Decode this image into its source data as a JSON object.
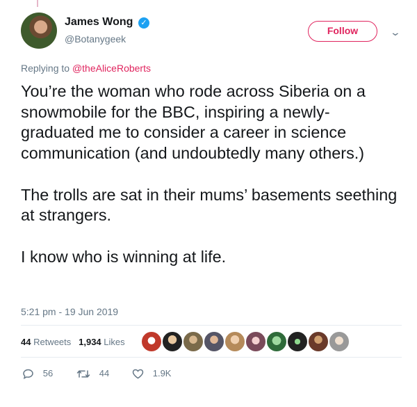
{
  "author": {
    "name": "James Wong",
    "handle": "@Botanygeek",
    "verified_icon": "verified-badge-icon"
  },
  "follow_label": "Follow",
  "reply_prefix": "Replying to ",
  "reply_mention": "@theAliceRoberts",
  "tweet": {
    "para1": "You’re the woman who rode across Siberia on a snowmobile for the BBC, inspiring a newly-graduated me to consider a career in science communication (and undoubtedly many others.)",
    "para2": "The trolls are sat in their mums’ basements seething at strangers.",
    "para3": "I know who is winning at life."
  },
  "timestamp": "5:21 pm - 19 Jun 2019",
  "stats": {
    "retweets_count": "44",
    "retweets_label": " Retweets",
    "likes_count": "1,934",
    "likes_label": " Likes"
  },
  "actions": {
    "reply_count": "56",
    "retweet_count": "44",
    "like_count": "1.9K"
  },
  "colors": {
    "accent": "#e0245e",
    "verified": "#1da1f2",
    "muted": "#657786"
  }
}
